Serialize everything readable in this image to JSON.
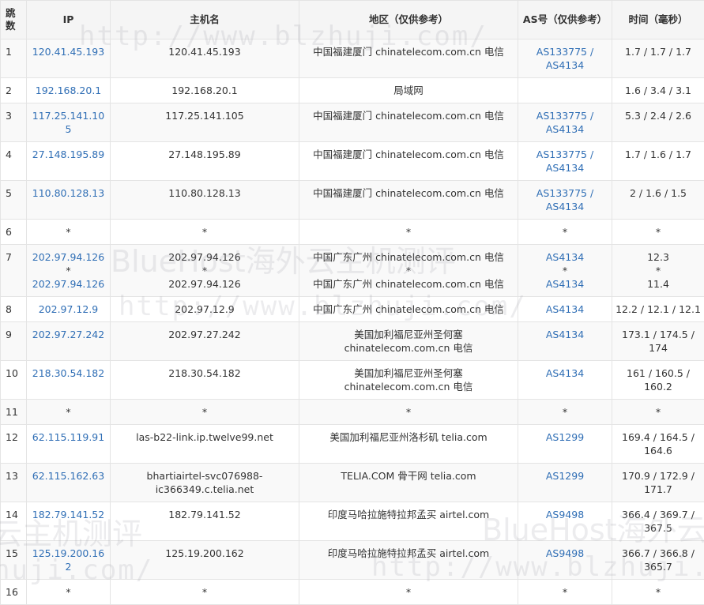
{
  "headers": {
    "hop": "跳数",
    "ip": "IP",
    "host": "主机名",
    "region": "地区（仅供参考）",
    "as": "AS号（仅供参考）",
    "time": "时间（毫秒）"
  },
  "rows": [
    {
      "hop": "1",
      "ip": [
        "120.41.45.193"
      ],
      "host": [
        "120.41.45.193"
      ],
      "region": [
        "中国福建厦门 chinatelecom.com.cn 电信"
      ],
      "as": [
        "AS133775 /",
        "AS4134"
      ],
      "time": [
        "1.7 / 1.7 / 1.7"
      ]
    },
    {
      "hop": "2",
      "ip": [
        "192.168.20.1"
      ],
      "host": [
        "192.168.20.1"
      ],
      "region": [
        "局域网"
      ],
      "as": [
        ""
      ],
      "time": [
        "1.6 / 3.4 / 3.1"
      ]
    },
    {
      "hop": "3",
      "ip": [
        "117.25.141.105"
      ],
      "host": [
        "117.25.141.105"
      ],
      "region": [
        "中国福建厦门 chinatelecom.com.cn 电信"
      ],
      "as": [
        "AS133775 /",
        "AS4134"
      ],
      "time": [
        "5.3 / 2.4 / 2.6"
      ]
    },
    {
      "hop": "4",
      "ip": [
        "27.148.195.89"
      ],
      "host": [
        "27.148.195.89"
      ],
      "region": [
        "中国福建厦门 chinatelecom.com.cn 电信"
      ],
      "as": [
        "AS133775 /",
        "AS4134"
      ],
      "time": [
        "1.7 / 1.6 / 1.7"
      ]
    },
    {
      "hop": "5",
      "ip": [
        "110.80.128.13"
      ],
      "host": [
        "110.80.128.13"
      ],
      "region": [
        "中国福建厦门 chinatelecom.com.cn 电信"
      ],
      "as": [
        "AS133775 /",
        "AS4134"
      ],
      "time": [
        "2 / 1.6 / 1.5"
      ]
    },
    {
      "hop": "6",
      "ip": [
        "*"
      ],
      "host": [
        "*"
      ],
      "region": [
        "*"
      ],
      "as": [
        "*"
      ],
      "time": [
        "*"
      ]
    },
    {
      "hop": "7",
      "ip": [
        "202.97.94.126",
        "*",
        "202.97.94.126"
      ],
      "host": [
        "202.97.94.126",
        "*",
        "202.97.94.126"
      ],
      "region": [
        "中国广东广州 chinatelecom.com.cn 电信",
        "*",
        "中国广东广州 chinatelecom.com.cn 电信"
      ],
      "as": [
        "AS4134",
        "*",
        "AS4134"
      ],
      "time": [
        "12.3",
        "*",
        "11.4"
      ]
    },
    {
      "hop": "8",
      "ip": [
        "202.97.12.9"
      ],
      "host": [
        "202.97.12.9"
      ],
      "region": [
        "中国广东广州 chinatelecom.com.cn 电信"
      ],
      "as": [
        "AS4134"
      ],
      "time": [
        "12.2 / 12.1 / 12.1"
      ]
    },
    {
      "hop": "9",
      "ip": [
        "202.97.27.242"
      ],
      "host": [
        "202.97.27.242"
      ],
      "region": [
        "美国加利福尼亚州圣何塞",
        "chinatelecom.com.cn 电信"
      ],
      "as": [
        "AS4134"
      ],
      "time": [
        "173.1 / 174.5 /",
        "174"
      ]
    },
    {
      "hop": "10",
      "ip": [
        "218.30.54.182"
      ],
      "host": [
        "218.30.54.182"
      ],
      "region": [
        "美国加利福尼亚州圣何塞",
        "chinatelecom.com.cn 电信"
      ],
      "as": [
        "AS4134"
      ],
      "time": [
        "161 / 160.5 /",
        "160.2"
      ]
    },
    {
      "hop": "11",
      "ip": [
        "*"
      ],
      "host": [
        "*"
      ],
      "region": [
        "*"
      ],
      "as": [
        "*"
      ],
      "time": [
        "*"
      ]
    },
    {
      "hop": "12",
      "ip": [
        "62.115.119.91"
      ],
      "host": [
        "las-b22-link.ip.twelve99.net"
      ],
      "region": [
        "美国加利福尼亚州洛杉矶 telia.com"
      ],
      "as": [
        "AS1299"
      ],
      "time": [
        "169.4 / 164.5 /",
        "164.6"
      ]
    },
    {
      "hop": "13",
      "ip": [
        "62.115.162.63"
      ],
      "host": [
        "bhartiairtel-svc076988-",
        "ic366349.c.telia.net"
      ],
      "region": [
        "TELIA.COM 骨干网 telia.com"
      ],
      "as": [
        "AS1299"
      ],
      "time": [
        "170.9 / 172.9 /",
        "171.7"
      ]
    },
    {
      "hop": "14",
      "ip": [
        "182.79.141.52"
      ],
      "host": [
        "182.79.141.52"
      ],
      "region": [
        "印度马哈拉施特拉邦孟买 airtel.com"
      ],
      "as": [
        "AS9498"
      ],
      "time": [
        "366.4 / 369.7 /",
        "367.5"
      ]
    },
    {
      "hop": "15",
      "ip": [
        "125.19.200.162"
      ],
      "host": [
        "125.19.200.162"
      ],
      "region": [
        "印度马哈拉施特拉邦孟买 airtel.com"
      ],
      "as": [
        "AS9498"
      ],
      "time": [
        "366.7 / 366.8 /",
        "365.7"
      ]
    },
    {
      "hop": "16",
      "ip": [
        "*"
      ],
      "host": [
        "*"
      ],
      "region": [
        "*"
      ],
      "as": [
        "*"
      ],
      "time": [
        "*"
      ]
    }
  ],
  "watermark": {
    "brand": "BlueHost海外云主机测评",
    "brand_partial": "云主机测评",
    "url": "http://www.blzhuji.com/",
    "url_partial": "huji.com/"
  },
  "colors": {
    "link": "#2f6eb5",
    "header_bg": "#f5f5f5",
    "border": "#e4e4e4"
  }
}
